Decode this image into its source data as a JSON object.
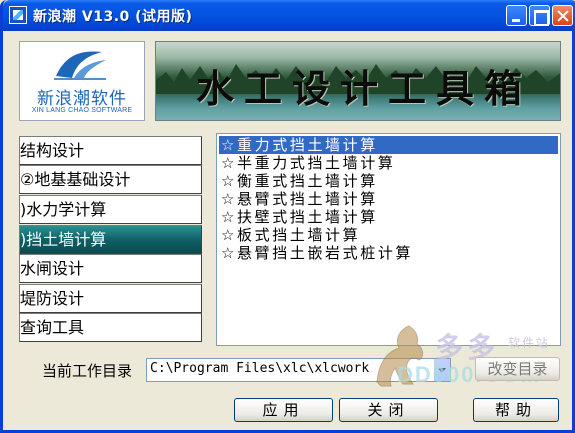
{
  "window": {
    "title": "新浪潮 V13.0 (试用版)"
  },
  "header": {
    "logo_name": "新浪潮软件",
    "logo_subtitle": "XIN LANG CHAO SOFTWARE",
    "banner_title": "水工设计工具箱"
  },
  "categories": [
    {
      "label": "结构设计",
      "active": false
    },
    {
      "label": "②地基基础设计",
      "active": false
    },
    {
      "label": ")水力学计算",
      "active": false
    },
    {
      "label": ")挡土墙计算",
      "active": true
    },
    {
      "label": "水闸设计",
      "active": false
    },
    {
      "label": "堤防设计",
      "active": false
    },
    {
      "label": "查询工具",
      "active": false
    }
  ],
  "tools": [
    {
      "label": "☆重力式挡土墙计算",
      "selected": true
    },
    {
      "label": "☆半重力式挡土墙计算",
      "selected": false
    },
    {
      "label": "☆衡重式挡土墙计算",
      "selected": false
    },
    {
      "label": "☆悬臂式挡土墙计算",
      "selected": false
    },
    {
      "label": "☆扶壁式挡土墙计算",
      "selected": false
    },
    {
      "label": "☆板式挡土墙计算",
      "selected": false
    },
    {
      "label": "☆悬臂挡土嵌岩式桩计算",
      "selected": false
    }
  ],
  "workdir": {
    "label": "当前工作目录",
    "value": "C:\\Program Files\\xlc\\xlcwork",
    "change_button": "改变目录"
  },
  "buttons": {
    "apply": "应用",
    "close": "关闭",
    "help": "帮助"
  },
  "watermark": {
    "chinese": "多多",
    "chinese_small": "软件站",
    "english": "DD000.COM"
  },
  "colors": {
    "titlebar": "#0454e2",
    "selection": "#316ac5",
    "active_category": "#0e5e63"
  }
}
